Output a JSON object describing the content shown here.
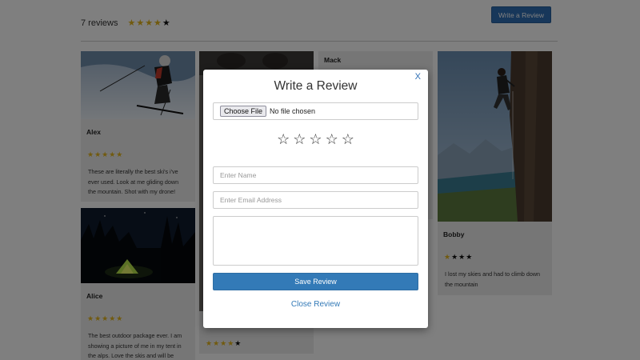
{
  "header": {
    "review_count": "7 reviews",
    "write_review_label": "Write a Review"
  },
  "reviews": [
    {
      "name": "Alex",
      "stars": "★★★★★",
      "text": "These are literally the best ski's i've ever used. Look at me gliding down the mountain. Shot with my drone!",
      "photo_icon": "skier-photo"
    },
    {
      "name": "Alice",
      "stars": "★★★★★",
      "text": "The best outdoor package ever. I am showing a picture of me in my tent in the alps. Love the skis and will be",
      "photo_icon": "tent-night-photo"
    },
    {
      "name": "Mack",
      "stars": "★★★★★",
      "text": "",
      "photo_icon": ""
    },
    {
      "name": "Bobby",
      "stars": "★★★★",
      "text": "I lost my skies and had to climb down the mountain",
      "photo_icon": "rock-climber-photo"
    }
  ],
  "modal": {
    "close_label": "X",
    "title": "Write a Review",
    "file_button_label": "Choose File",
    "file_status": "No file chosen",
    "rating_stars": [
      "☆",
      "☆",
      "☆",
      "☆",
      "☆"
    ],
    "name_placeholder": "Enter Name",
    "email_placeholder": "Enter Email Address",
    "textarea_value": "",
    "save_label": "Save Review",
    "close_review_label": "Close Review"
  },
  "colors": {
    "accent": "#337ab7",
    "star_gold": "#e3b51c",
    "overlay": "rgba(0,0,0,0.5)"
  }
}
